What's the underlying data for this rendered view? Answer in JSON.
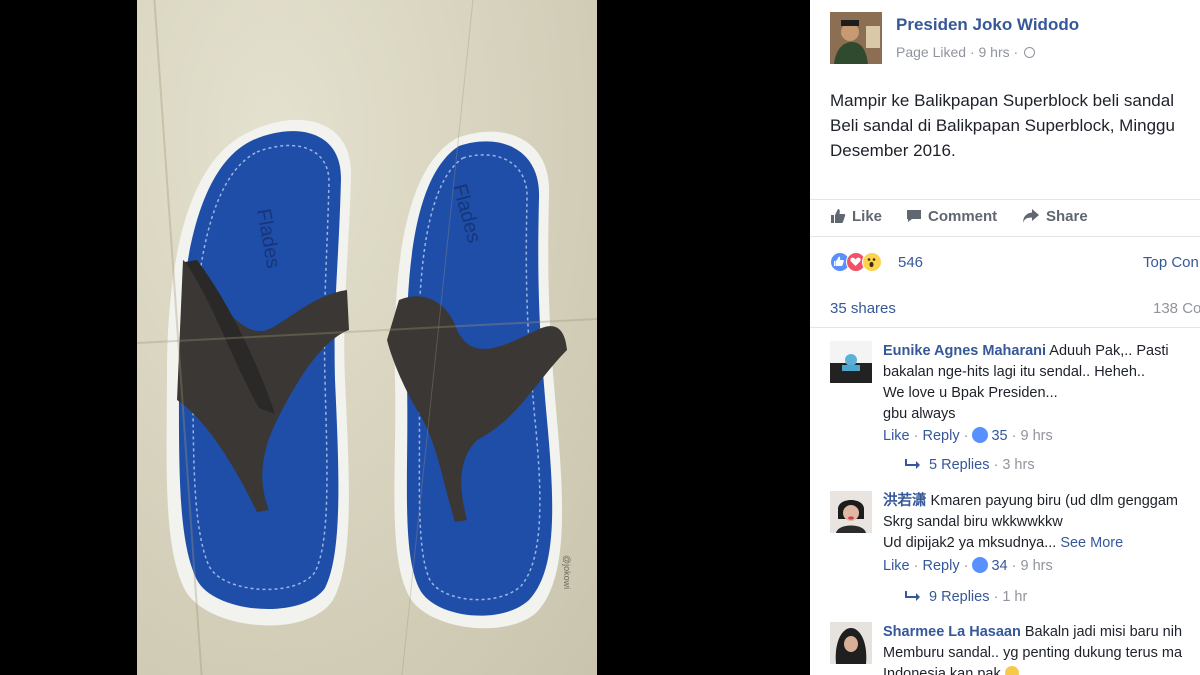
{
  "photo": {
    "subject": "blue flip-flop sandals",
    "brand_left": "Flades",
    "brand_right": "Flades",
    "watermark": "@jokowi"
  },
  "post": {
    "page_name": "Presiden Joko Widodo",
    "meta": "Page Liked · 9 hrs ·",
    "text_lines": [
      "Mampir ke Balikpapan Superblock beli sandal",
      "Beli sandal di Balikpapan Superblock, Minggu",
      "Desember 2016."
    ],
    "actions": {
      "like": "Like",
      "comment": "Comment",
      "share": "Share"
    },
    "reaction_count": "546",
    "top_comments": "Top Con",
    "shares": "35 shares",
    "comment_count": "138 Co"
  },
  "comments": [
    {
      "name": "Eunike Agnes Maharani",
      "text_lines": [
        " Aduuh Pak,.. Pasti",
        "bakalan nge-hits lagi itu sendal.. Heheh..",
        "We love u Bpak Presiden...",
        "gbu always"
      ],
      "like": "Like",
      "reply": "Reply",
      "likes": "35",
      "time": "9 hrs",
      "replies": "5 Replies",
      "replies_time": "3 hrs"
    },
    {
      "name": "洪若潇",
      "text_lines": [
        " Kmaren payung biru (ud dlm genggam",
        "Skrg sandal biru wkkwwkkw",
        "Ud dipijak2 ya mksudnya..."
      ],
      "see_more": "See More",
      "like": "Like",
      "reply": "Reply",
      "likes": "34",
      "time": "9 hrs",
      "replies": "9 Replies",
      "replies_time": "1 hr"
    },
    {
      "name": "Sharmee La Hasaan",
      "text_lines": [
        " Bakaln jadi misi baru nih",
        "Memburu sandal.. yg penting dukung terus ma",
        "Indonesia kan pak"
      ]
    }
  ],
  "colors": {
    "link_blue": "#365899",
    "muted": "#90949c",
    "sandal_blue": "#1f4ea8",
    "strap": "#3a3734"
  }
}
